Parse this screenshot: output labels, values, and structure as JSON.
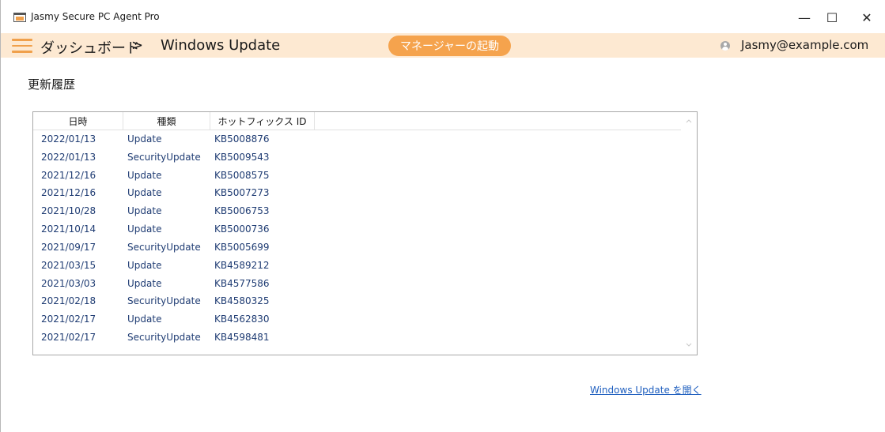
{
  "window": {
    "title": "Jasmy Secure PC Agent Pro",
    "minimize_glyph": "—",
    "maximize_glyph": "☐",
    "close_glyph": "✕"
  },
  "header": {
    "breadcrumb_root": "ダッシュボード",
    "breadcrumb_separator": ">",
    "page_title": "Windows Update",
    "launch_manager_label": "マネージャーの起動",
    "user_email": "Jasmy@example.com"
  },
  "section": {
    "title": "更新履歴"
  },
  "table": {
    "columns": {
      "date": "日時",
      "type": "種類",
      "hotfix": "ホットフィックス ID"
    },
    "rows": [
      {
        "date": "2022/01/13",
        "type": "Update",
        "hotfix": "KB5008876"
      },
      {
        "date": "2022/01/13",
        "type": "SecurityUpdate",
        "hotfix": "KB5009543"
      },
      {
        "date": "2021/12/16",
        "type": "Update",
        "hotfix": "KB5008575"
      },
      {
        "date": "2021/12/16",
        "type": "Update",
        "hotfix": "KB5007273"
      },
      {
        "date": "2021/10/28",
        "type": "Update",
        "hotfix": "KB5006753"
      },
      {
        "date": "2021/10/14",
        "type": "Update",
        "hotfix": "KB5000736"
      },
      {
        "date": "2021/09/17",
        "type": "SecurityUpdate",
        "hotfix": "KB5005699"
      },
      {
        "date": "2021/03/15",
        "type": "Update",
        "hotfix": "KB4589212"
      },
      {
        "date": "2021/03/03",
        "type": "Update",
        "hotfix": "KB4577586"
      },
      {
        "date": "2021/02/18",
        "type": "SecurityUpdate",
        "hotfix": "KB4580325"
      },
      {
        "date": "2021/02/17",
        "type": "Update",
        "hotfix": "KB4562830"
      },
      {
        "date": "2021/02/17",
        "type": "SecurityUpdate",
        "hotfix": "KB4598481"
      }
    ]
  },
  "footer": {
    "open_windows_update_link": "Windows Update を開く"
  },
  "colors": {
    "accent": "#f5a34d",
    "header_bg": "#fde9d2",
    "row_text": "#1f3c73",
    "link": "#1f5fbf"
  },
  "icons": {
    "app": "app-window-icon",
    "menu": "hamburger-menu-icon",
    "user": "user-icon",
    "scroll_up": "chevron-up-icon",
    "scroll_down": "chevron-down-icon"
  }
}
